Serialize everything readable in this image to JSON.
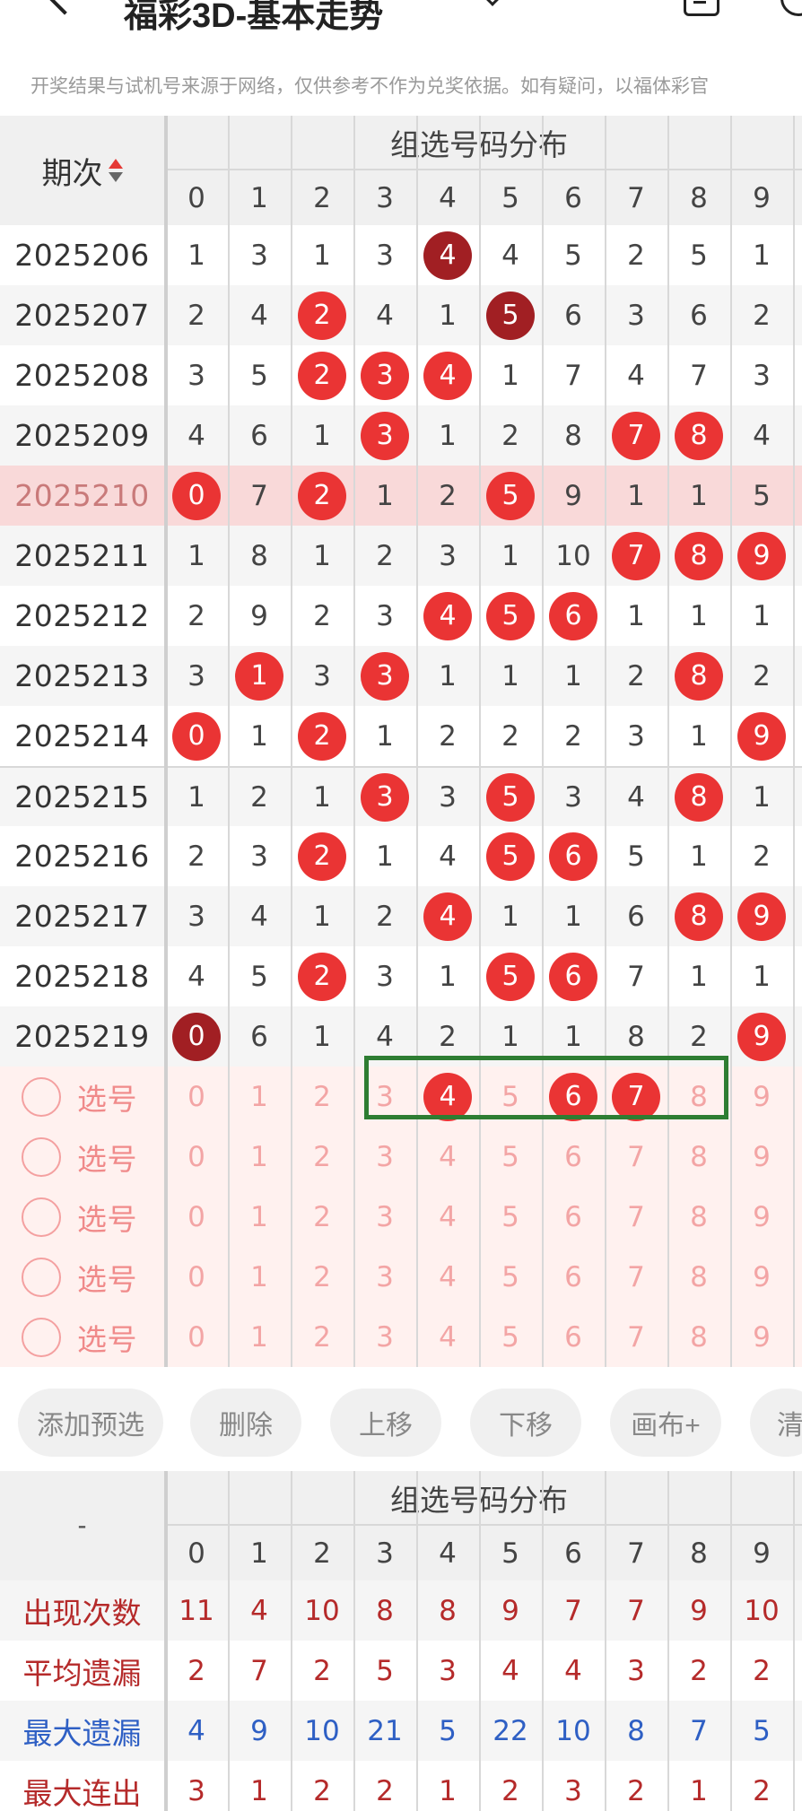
{
  "header": {
    "title": "福彩3D-基本走势",
    "notice": "开奖结果与试机号来源于网络，仅供参考不作为兑奖依据。如有疑问，以福体彩官"
  },
  "colors": {
    "red_ball": "#ea3434",
    "dark_ball": "#a11f23",
    "highlight_row": "#f9d9d9",
    "selection_box": "#2e7d32",
    "stat_red": "#b52a2a",
    "stat_blue": "#2e5fc4"
  },
  "main_table": {
    "section_title": "组选号码分布",
    "period_label": "期次",
    "digits": [
      "0",
      "1",
      "2",
      "3",
      "4",
      "5",
      "6",
      "7",
      "8",
      "9"
    ],
    "rows": [
      {
        "period": "2025206",
        "cells": [
          "1",
          "3",
          "1",
          "3",
          "4",
          "4",
          "5",
          "2",
          "5",
          "1"
        ],
        "balls": {
          "4": "dark"
        }
      },
      {
        "period": "2025207",
        "cells": [
          "2",
          "4",
          "2",
          "4",
          "1",
          "5",
          "6",
          "3",
          "6",
          "2"
        ],
        "balls": {
          "2": "red",
          "5": "dark"
        }
      },
      {
        "period": "2025208",
        "cells": [
          "3",
          "5",
          "2",
          "3",
          "4",
          "1",
          "7",
          "4",
          "7",
          "3"
        ],
        "balls": {
          "2": "red",
          "3": "red",
          "4": "red"
        }
      },
      {
        "period": "2025209",
        "cells": [
          "4",
          "6",
          "1",
          "3",
          "1",
          "2",
          "8",
          "7",
          "8",
          "4"
        ],
        "balls": {
          "3": "red",
          "7": "red",
          "8": "red"
        }
      },
      {
        "period": "2025210",
        "cells": [
          "0",
          "7",
          "2",
          "1",
          "2",
          "5",
          "9",
          "1",
          "1",
          "5"
        ],
        "balls": {
          "0": "red",
          "2": "red",
          "5": "red"
        },
        "highlight": true
      },
      {
        "period": "2025211",
        "cells": [
          "1",
          "8",
          "1",
          "2",
          "3",
          "1",
          "10",
          "7",
          "8",
          "9"
        ],
        "balls": {
          "7": "red",
          "8": "red",
          "9": "red"
        }
      },
      {
        "period": "2025212",
        "cells": [
          "2",
          "9",
          "2",
          "3",
          "4",
          "5",
          "6",
          "1",
          "1",
          "1"
        ],
        "balls": {
          "4": "red",
          "5": "red",
          "6": "red"
        }
      },
      {
        "period": "2025213",
        "cells": [
          "3",
          "1",
          "3",
          "3",
          "1",
          "1",
          "1",
          "2",
          "8",
          "2"
        ],
        "balls": {
          "1": "red",
          "3": "red",
          "8": "red"
        }
      },
      {
        "period": "2025214",
        "cells": [
          "0",
          "1",
          "2",
          "1",
          "2",
          "2",
          "2",
          "3",
          "1",
          "9"
        ],
        "balls": {
          "0": "red",
          "2": "red",
          "9": "red"
        }
      },
      {
        "period": "2025215",
        "cells": [
          "1",
          "2",
          "1",
          "3",
          "3",
          "5",
          "3",
          "4",
          "8",
          "1"
        ],
        "balls": {
          "3": "red",
          "5": "red",
          "8": "red"
        }
      },
      {
        "period": "2025216",
        "cells": [
          "2",
          "3",
          "2",
          "1",
          "4",
          "5",
          "6",
          "5",
          "1",
          "2"
        ],
        "balls": {
          "2": "red",
          "5": "red",
          "6": "red"
        }
      },
      {
        "period": "2025217",
        "cells": [
          "3",
          "4",
          "1",
          "2",
          "4",
          "1",
          "1",
          "6",
          "8",
          "9"
        ],
        "balls": {
          "4": "red",
          "8": "red",
          "9": "red"
        }
      },
      {
        "period": "2025218",
        "cells": [
          "4",
          "5",
          "2",
          "3",
          "1",
          "5",
          "6",
          "7",
          "1",
          "1"
        ],
        "balls": {
          "2": "red",
          "5": "red",
          "6": "red"
        }
      },
      {
        "period": "2025219",
        "cells": [
          "0",
          "6",
          "1",
          "4",
          "2",
          "1",
          "1",
          "8",
          "2",
          "9"
        ],
        "balls": {
          "0": "dark",
          "9": "red"
        }
      }
    ],
    "select_rows": [
      {
        "label": "选号",
        "cells": [
          "0",
          "1",
          "2",
          "3",
          "4",
          "5",
          "6",
          "7",
          "8",
          "9"
        ],
        "balls": {
          "4": "red",
          "6": "red",
          "7": "red"
        }
      },
      {
        "label": "选号",
        "cells": [
          "0",
          "1",
          "2",
          "3",
          "4",
          "5",
          "6",
          "7",
          "8",
          "9"
        ],
        "balls": {}
      },
      {
        "label": "选号",
        "cells": [
          "0",
          "1",
          "2",
          "3",
          "4",
          "5",
          "6",
          "7",
          "8",
          "9"
        ],
        "balls": {}
      },
      {
        "label": "选号",
        "cells": [
          "0",
          "1",
          "2",
          "3",
          "4",
          "5",
          "6",
          "7",
          "8",
          "9"
        ],
        "balls": {}
      },
      {
        "label": "选号",
        "cells": [
          "0",
          "1",
          "2",
          "3",
          "4",
          "5",
          "6",
          "7",
          "8",
          "9"
        ],
        "balls": {}
      }
    ]
  },
  "buttons": [
    "添加预选",
    "删除",
    "上移",
    "下移",
    "画布+",
    "清"
  ],
  "stats_table": {
    "section_title": "组选号码分布",
    "corner_label": "-",
    "digits": [
      "0",
      "1",
      "2",
      "3",
      "4",
      "5",
      "6",
      "7",
      "8",
      "9"
    ],
    "rows": [
      {
        "label": "出现次数",
        "color": "red",
        "values": [
          "11",
          "4",
          "10",
          "8",
          "8",
          "9",
          "7",
          "7",
          "9",
          "10"
        ]
      },
      {
        "label": "平均遗漏",
        "color": "red",
        "values": [
          "2",
          "7",
          "2",
          "5",
          "3",
          "4",
          "4",
          "3",
          "2",
          "2"
        ]
      },
      {
        "label": "最大遗漏",
        "color": "blue",
        "values": [
          "4",
          "9",
          "10",
          "21",
          "5",
          "22",
          "10",
          "8",
          "7",
          "5"
        ]
      },
      {
        "label": "最大连出",
        "color": "red",
        "values": [
          "3",
          "1",
          "2",
          "2",
          "1",
          "2",
          "3",
          "2",
          "1",
          "2"
        ]
      }
    ]
  }
}
